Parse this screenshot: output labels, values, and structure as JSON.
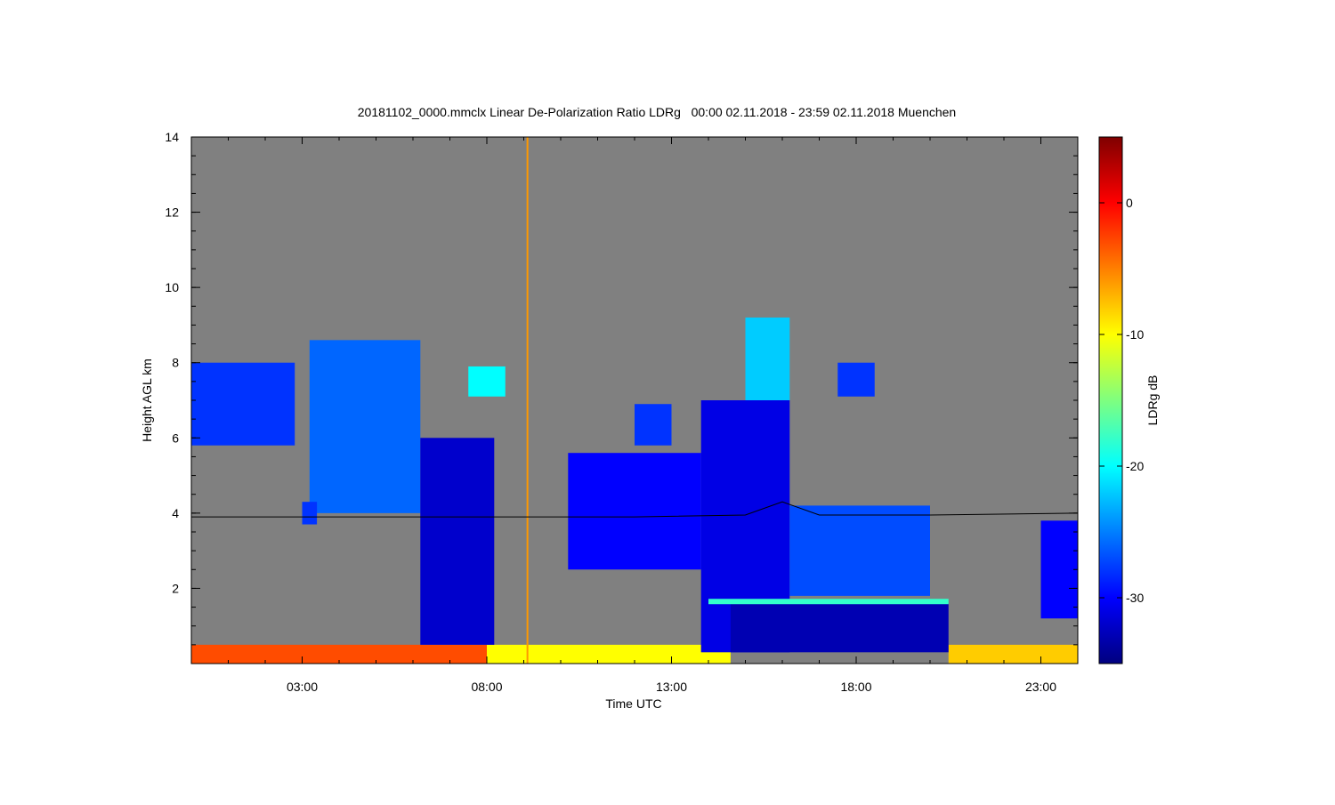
{
  "chart_data": {
    "type": "heatmap",
    "title": "20181102_0000.mmclx Linear De-Polarization Ratio LDRg   00:00 02.11.2018 - 23:59 02.11.2018 Muenchen",
    "xlabel": "Time UTC",
    "ylabel": "Height AGL km",
    "colorbar_label": "LDRg dB",
    "x_unit": "hours UTC",
    "xlim": [
      0,
      24
    ],
    "ylim": [
      0,
      14
    ],
    "x_ticks": [
      {
        "value": 3,
        "label": "03:00"
      },
      {
        "value": 8,
        "label": "08:00"
      },
      {
        "value": 13,
        "label": "13:00"
      },
      {
        "value": 18,
        "label": "18:00"
      },
      {
        "value": 23,
        "label": "23:00"
      }
    ],
    "y_ticks": [
      {
        "value": 2,
        "label": "2"
      },
      {
        "value": 4,
        "label": "4"
      },
      {
        "value": 6,
        "label": "6"
      },
      {
        "value": 8,
        "label": "8"
      },
      {
        "value": 10,
        "label": "10"
      },
      {
        "value": 12,
        "label": "12"
      },
      {
        "value": 14,
        "label": "14"
      }
    ],
    "color_range": [
      -35,
      5
    ],
    "colorbar_ticks": [
      {
        "value": 0,
        "label": "0"
      },
      {
        "value": -10,
        "label": "-10"
      },
      {
        "value": -20,
        "label": "-20"
      },
      {
        "value": -30,
        "label": "-30"
      }
    ],
    "colormap": [
      "#00007f",
      "#0000ff",
      "#007fff",
      "#00ffff",
      "#7fff7f",
      "#ffff00",
      "#ff7f00",
      "#ff0000",
      "#7f0000"
    ],
    "background_color": "#808080",
    "grid": false,
    "regions": [
      {
        "name": "cirrus-early",
        "t0": 0.0,
        "t1": 2.8,
        "bottom": 5.8,
        "top": 8.0,
        "ldr": -28
      },
      {
        "name": "cirrus-fallstreak-1",
        "t0": 3.2,
        "t1": 6.2,
        "bottom": 4.0,
        "top": 8.6,
        "ldr": -26
      },
      {
        "name": "cirrus-fallstreak-2",
        "t0": 6.2,
        "t1": 8.2,
        "bottom": 0.5,
        "top": 6.0,
        "ldr": -32
      },
      {
        "name": "cloud-patch-mid",
        "t0": 7.5,
        "t1": 8.5,
        "bottom": 7.1,
        "top": 7.9,
        "ldr": -20
      },
      {
        "name": "small-echo-low",
        "t0": 3.0,
        "t1": 3.4,
        "bottom": 3.7,
        "top": 4.3,
        "ldr": -28
      },
      {
        "name": "mid-cloud-1",
        "t0": 10.2,
        "t1": 13.8,
        "bottom": 2.5,
        "top": 5.6,
        "ldr": -30
      },
      {
        "name": "mid-cloud-upper",
        "t0": 12.0,
        "t1": 13.0,
        "bottom": 5.8,
        "top": 6.9,
        "ldr": -28
      },
      {
        "name": "deep-cloud-main",
        "t0": 13.8,
        "t1": 16.2,
        "bottom": 0.3,
        "top": 7.0,
        "ldr": -31
      },
      {
        "name": "cirrus-tower",
        "t0": 15.0,
        "t1": 16.2,
        "bottom": 7.0,
        "top": 9.2,
        "ldr": -22
      },
      {
        "name": "fallstreak-layer",
        "t0": 16.2,
        "t1": 20.0,
        "bottom": 1.8,
        "top": 4.2,
        "ldr": -27
      },
      {
        "name": "low-cloud-block",
        "t0": 14.6,
        "t1": 20.5,
        "bottom": 0.3,
        "top": 1.6,
        "ldr": -33
      },
      {
        "name": "cirrus-small-right",
        "t0": 17.5,
        "t1": 18.5,
        "bottom": 7.1,
        "top": 8.0,
        "ldr": -28
      },
      {
        "name": "late-echo",
        "t0": 23.0,
        "t1": 24.0,
        "bottom": 1.2,
        "top": 3.8,
        "ldr": -30
      }
    ],
    "melting_layer": {
      "height_km": 1.65,
      "t0": 14.0,
      "t1": 20.5,
      "ldr": -18
    },
    "surface_clutter": [
      {
        "t0": 0.0,
        "t1": 8.0,
        "bottom": 0.0,
        "top": 0.5,
        "ldr": -3
      },
      {
        "t0": 8.0,
        "t1": 14.6,
        "bottom": 0.0,
        "top": 0.5,
        "ldr": -10
      },
      {
        "t0": 20.5,
        "t1": 24.0,
        "bottom": 0.0,
        "top": 0.5,
        "ldr": -8
      }
    ],
    "spike": {
      "time_h": 9.1,
      "ldr": -6
    },
    "isotherm_line": [
      {
        "time": 0.0,
        "height": 3.9
      },
      {
        "time": 4.0,
        "height": 3.9
      },
      {
        "time": 8.0,
        "height": 3.9
      },
      {
        "time": 12.0,
        "height": 3.9
      },
      {
        "time": 15.0,
        "height": 3.95
      },
      {
        "time": 16.0,
        "height": 4.3
      },
      {
        "time": 17.0,
        "height": 3.95
      },
      {
        "time": 20.0,
        "height": 3.95
      },
      {
        "time": 24.0,
        "height": 4.0
      }
    ]
  }
}
